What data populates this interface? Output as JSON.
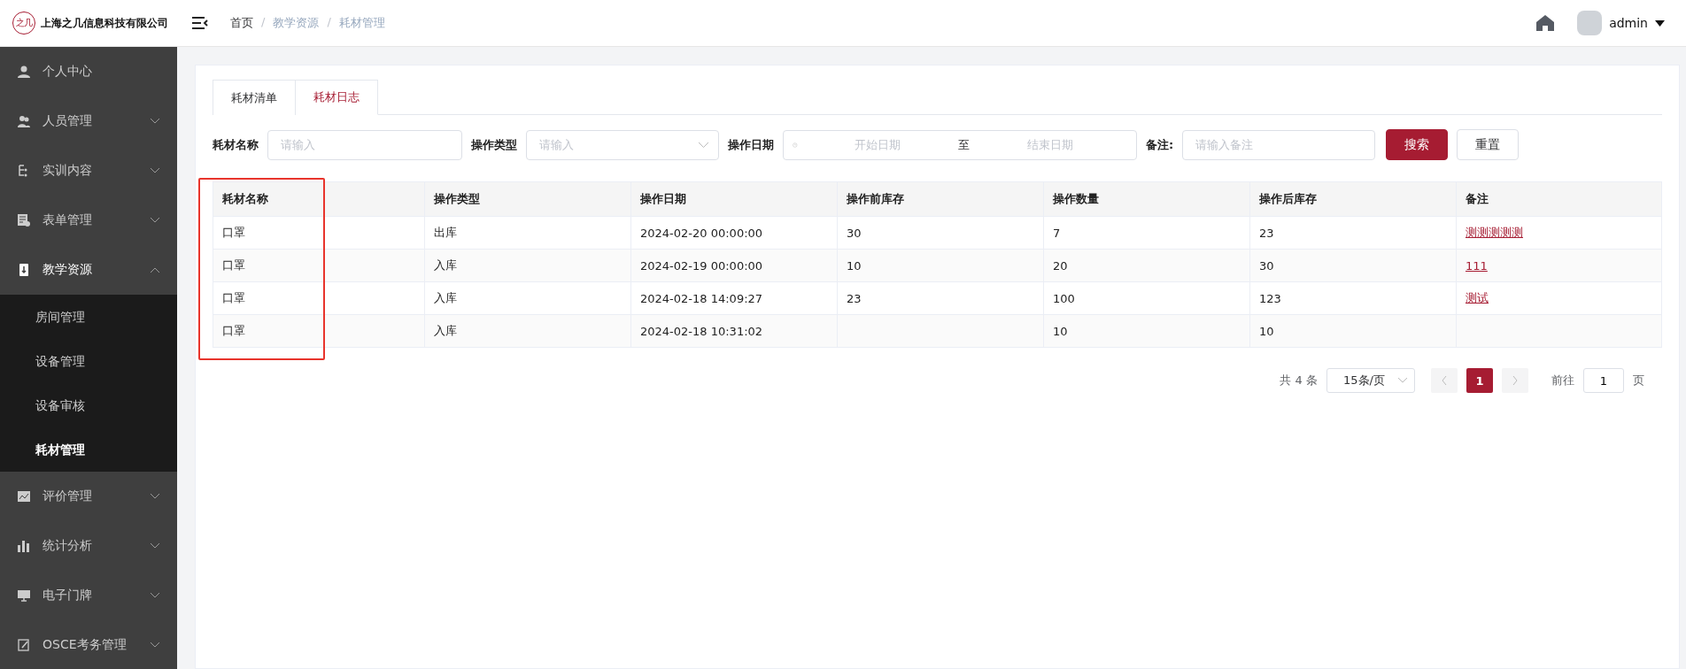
{
  "header": {
    "company": "上海之几信息科技有限公司",
    "logo_text": "之几",
    "breadcrumb": [
      {
        "label": "首页",
        "kind": "link"
      },
      {
        "label": "/",
        "kind": "separator"
      },
      {
        "label": "教学资源",
        "kind": "current"
      },
      {
        "label": "/",
        "kind": "separator"
      },
      {
        "label": "耗材管理",
        "kind": "current"
      }
    ],
    "user": "admin"
  },
  "sidebar": {
    "items": [
      {
        "label": "个人中心",
        "has_children": false,
        "expanded": false
      },
      {
        "label": "人员管理",
        "has_children": true,
        "expanded": false
      },
      {
        "label": "实训内容",
        "has_children": true,
        "expanded": false
      },
      {
        "label": "表单管理",
        "has_children": true,
        "expanded": false
      },
      {
        "label": "教学资源",
        "has_children": true,
        "expanded": true,
        "children": [
          {
            "label": "房间管理",
            "selected": false
          },
          {
            "label": "设备管理",
            "selected": false
          },
          {
            "label": "设备审核",
            "selected": false
          },
          {
            "label": "耗材管理",
            "selected": true
          }
        ]
      },
      {
        "label": "评价管理",
        "has_children": true,
        "expanded": false
      },
      {
        "label": "统计分析",
        "has_children": true,
        "expanded": false
      },
      {
        "label": "电子门牌",
        "has_children": true,
        "expanded": false
      },
      {
        "label": "OSCE考务管理",
        "has_children": true,
        "expanded": false
      }
    ]
  },
  "tabs": [
    {
      "label": "耗材清单",
      "selected": false
    },
    {
      "label": "耗材日志",
      "selected": true
    }
  ],
  "filters": {
    "name_label": "耗材名称",
    "name_placeholder": "请输入",
    "type_label": "操作类型",
    "type_placeholder": "请输入",
    "date_label": "操作日期",
    "date_start_placeholder": "开始日期",
    "date_separator": "至",
    "date_end_placeholder": "结束日期",
    "note_label": "备注:",
    "note_placeholder": "请输入备注",
    "search_button": "搜索",
    "reset_button": "重置"
  },
  "table": {
    "columns": [
      "耗材名称",
      "操作类型",
      "操作日期",
      "操作前库存",
      "操作数量",
      "操作后库存",
      "备注"
    ],
    "rows": [
      [
        "口罩",
        "出库",
        "2024-02-20 00:00:00",
        "30",
        "7",
        "23",
        "测测测测测"
      ],
      [
        "口罩",
        "入库",
        "2024-02-19 00:00:00",
        "10",
        "20",
        "30",
        "111"
      ],
      [
        "口罩",
        "入库",
        "2024-02-18 14:09:27",
        "23",
        "100",
        "123",
        "测试"
      ],
      [
        "口罩",
        "入库",
        "2024-02-18 10:31:02",
        "",
        "10",
        "10",
        ""
      ]
    ]
  },
  "pagination": {
    "total": "共 4 条",
    "page_size": "15条/页",
    "pages": [
      {
        "label": "1",
        "selected": true
      }
    ],
    "goto_label": "前往",
    "goto_value": "1",
    "page_suffix": "页"
  }
}
